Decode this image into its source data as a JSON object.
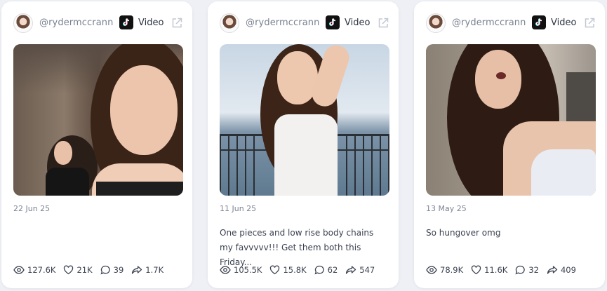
{
  "cards": [
    {
      "handle": "@rydermccrann",
      "media_type": "Video",
      "platform_icon": "tiktok-icon",
      "date": "22 Jun 25",
      "caption": "",
      "stats": {
        "views": "127.6K",
        "likes": "21K",
        "comments": "39",
        "shares": "1.7K"
      }
    },
    {
      "handle": "@rydermccrann",
      "media_type": "Video",
      "platform_icon": "tiktok-icon",
      "date": "11 Jun 25",
      "caption": "One pieces and low rise body chains my favvvvv!!! Get them both this Friday...",
      "stats": {
        "views": "105.5K",
        "likes": "15.8K",
        "comments": "62",
        "shares": "547"
      }
    },
    {
      "handle": "@rydermccrann",
      "media_type": "Video",
      "platform_icon": "tiktok-icon",
      "date": "13 May 25",
      "caption": "So hungover omg",
      "stats": {
        "views": "78.9K",
        "likes": "11.6K",
        "comments": "32",
        "shares": "409"
      }
    }
  ],
  "colors": {
    "background": "#eef0f5",
    "card": "#ffffff",
    "muted_text": "#7d8494",
    "text": "#3b4150"
  }
}
